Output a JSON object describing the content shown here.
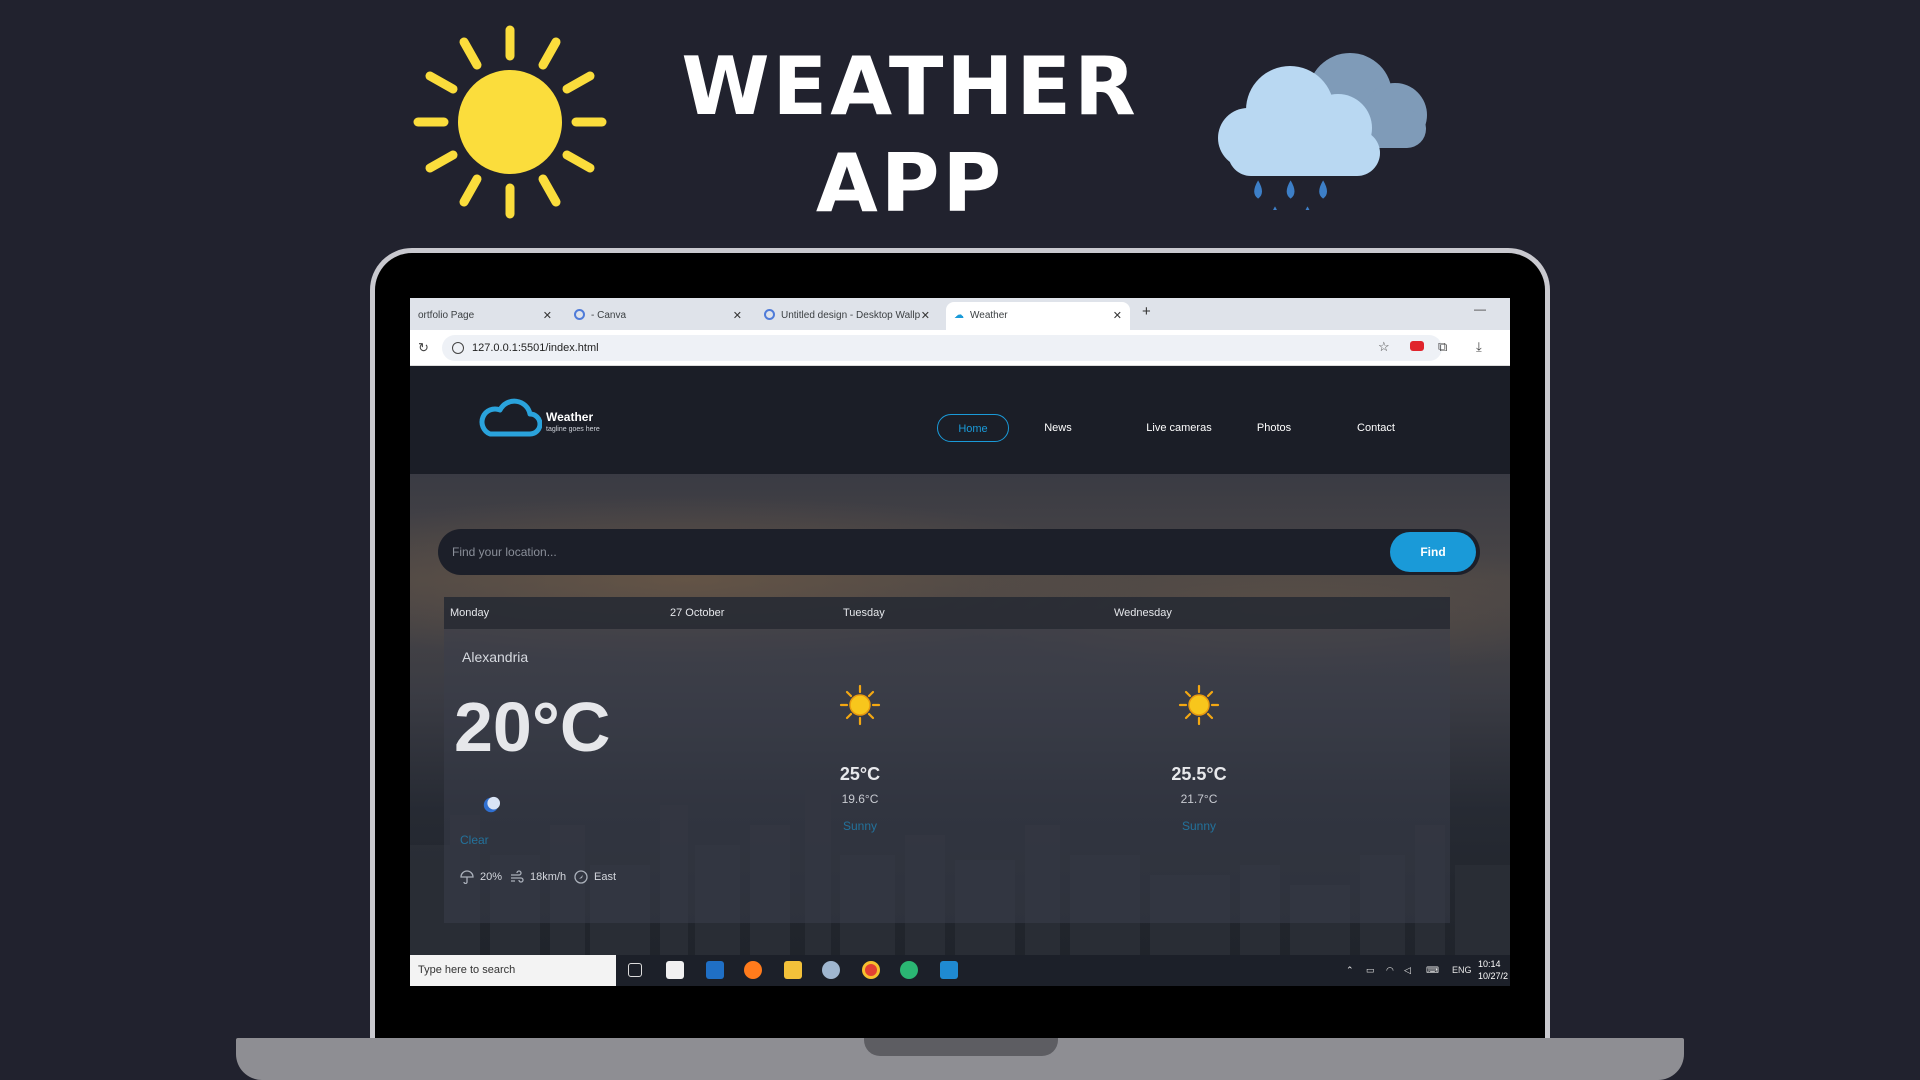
{
  "promo": {
    "title_line1": "WEATHER",
    "title_line2": "APP"
  },
  "browser": {
    "tabs": [
      {
        "label": "ortfolio Page"
      },
      {
        "label": "- Canva"
      },
      {
        "label": "Untitled design - Desktop Wallp"
      },
      {
        "label": "Weather",
        "active": true
      }
    ],
    "close_glyph": "✕",
    "new_tab_glyph": "+",
    "minimize_glyph": "—",
    "url": "127.0.0.1:5501/index.html"
  },
  "site": {
    "logo_name": "Weather",
    "tagline": "tagline goes here",
    "nav": [
      "Home",
      "News",
      "Live cameras",
      "Photos",
      "Contact"
    ],
    "search": {
      "placeholder": "Find your location...",
      "button": "Find"
    }
  },
  "forecast": {
    "today": {
      "day": "Monday",
      "date": "27 October",
      "city": "Alexandria",
      "temp": "20°C",
      "condition": "Clear",
      "icon": "moon-icon",
      "rain": "20%",
      "wind": "18km/h",
      "direction": "East"
    },
    "days": [
      {
        "day": "Tuesday",
        "max": "25°C",
        "min": "19.6°C",
        "condition": "Sunny",
        "icon": "sun-icon"
      },
      {
        "day": "Wednesday",
        "max": "25.5°C",
        "min": "21.7°C",
        "condition": "Sunny",
        "icon": "sun-icon"
      }
    ]
  },
  "taskbar": {
    "search_placeholder": "Type here to search",
    "lang": "ENG",
    "time": "10:14",
    "date": "10/27/2"
  },
  "colors": {
    "accent": "#1a9ad8",
    "sun": "#fbdd3c",
    "background": "#21222e"
  }
}
